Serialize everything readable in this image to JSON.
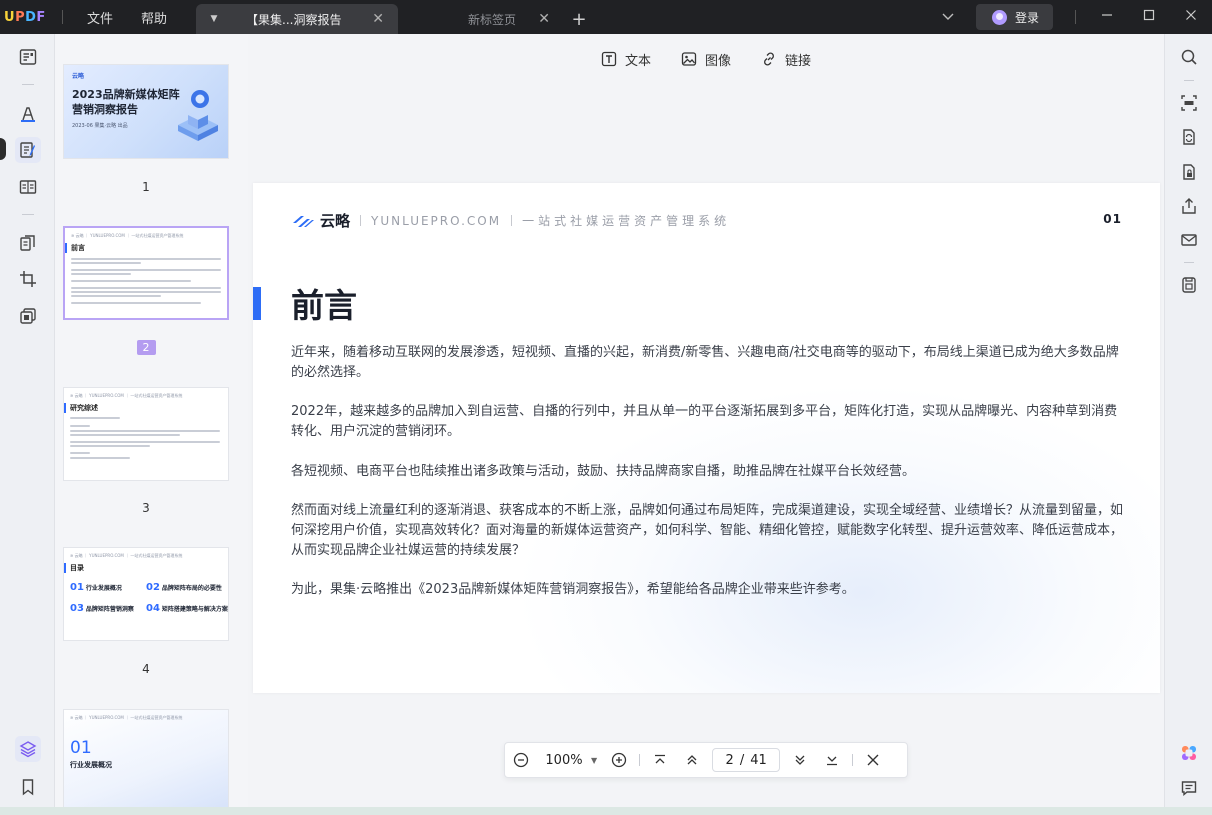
{
  "app": {
    "logo": {
      "u": "U",
      "p": "P",
      "d": "D",
      "f": "F"
    },
    "menu": {
      "file": "文件",
      "help": "帮助"
    },
    "tabs": [
      {
        "label": "【果集...洞察报告",
        "active": true
      },
      {
        "label": "新标签页",
        "active": false
      }
    ],
    "login_label": "登录"
  },
  "toolbar": {
    "text": "文本",
    "image": "图像",
    "link": "链接"
  },
  "thumbnails": {
    "pages": [
      "1",
      "2",
      "3",
      "4"
    ],
    "page1": {
      "brand": "云略",
      "title": "2023品牌新媒体矩阵营销洞察报告",
      "subtitle": "2023-06 果集·云略 出品"
    },
    "page2": {
      "heading": "前言"
    },
    "page3": {
      "heading": "研究综述"
    },
    "page4": {
      "heading": "目录",
      "toc": [
        {
          "num": "01",
          "label": "行业发展概况"
        },
        {
          "num": "02",
          "label": "品牌矩阵布局的必要性"
        },
        {
          "num": "03",
          "label": "品牌矩阵营销洞察"
        },
        {
          "num": "04",
          "label": "矩阵搭建策略与解决方案"
        }
      ]
    },
    "page5": {
      "num": "01",
      "label": "行业发展概况"
    }
  },
  "document": {
    "brand": "云略",
    "url": "YUNLUEPRO.COM",
    "slogan": "一站式社媒运营资产管理系统",
    "page_number": "01",
    "title": "前言",
    "paragraphs": [
      "近年来，随着移动互联网的发展渗透，短视频、直播的兴起，新消费/新零售、兴趣电商/社交电商等的驱动下，布局线上渠道已成为绝大多数品牌的必然选择。",
      "2022年，越来越多的品牌加入到自运营、自播的行列中，并且从单一的平台逐渐拓展到多平台，矩阵化打造，实现从品牌曝光、内容种草到消费转化、用户沉淀的营销闭环。",
      "各短视频、电商平台也陆续推出诸多政策与活动，鼓励、扶持品牌商家自播，助推品牌在社媒平台长效经营。",
      "然而面对线上流量红利的逐渐消退、获客成本的不断上涨，品牌如何通过布局矩阵，完成渠道建设，实现全域经营、业绩增长？从流量到留量，如何深挖用户价值，实现高效转化？面对海量的新媒体运营资产，如何科学、智能、精细化管控，赋能数字化转型、提升运营效率、降低运营成本，从而实现品牌企业社媒运营的持续发展？",
      "为此，果集·云略推出《2023品牌新媒体矩阵营销洞察报告》，希望能给各品牌企业带来些许参考。"
    ]
  },
  "navigation": {
    "zoom": "100%",
    "current_page": "2",
    "page_separator": "/",
    "total_pages": "41"
  },
  "colors": {
    "accent": "#2d6df6",
    "selection": "#b49cf0",
    "titlebar": "#202124"
  }
}
